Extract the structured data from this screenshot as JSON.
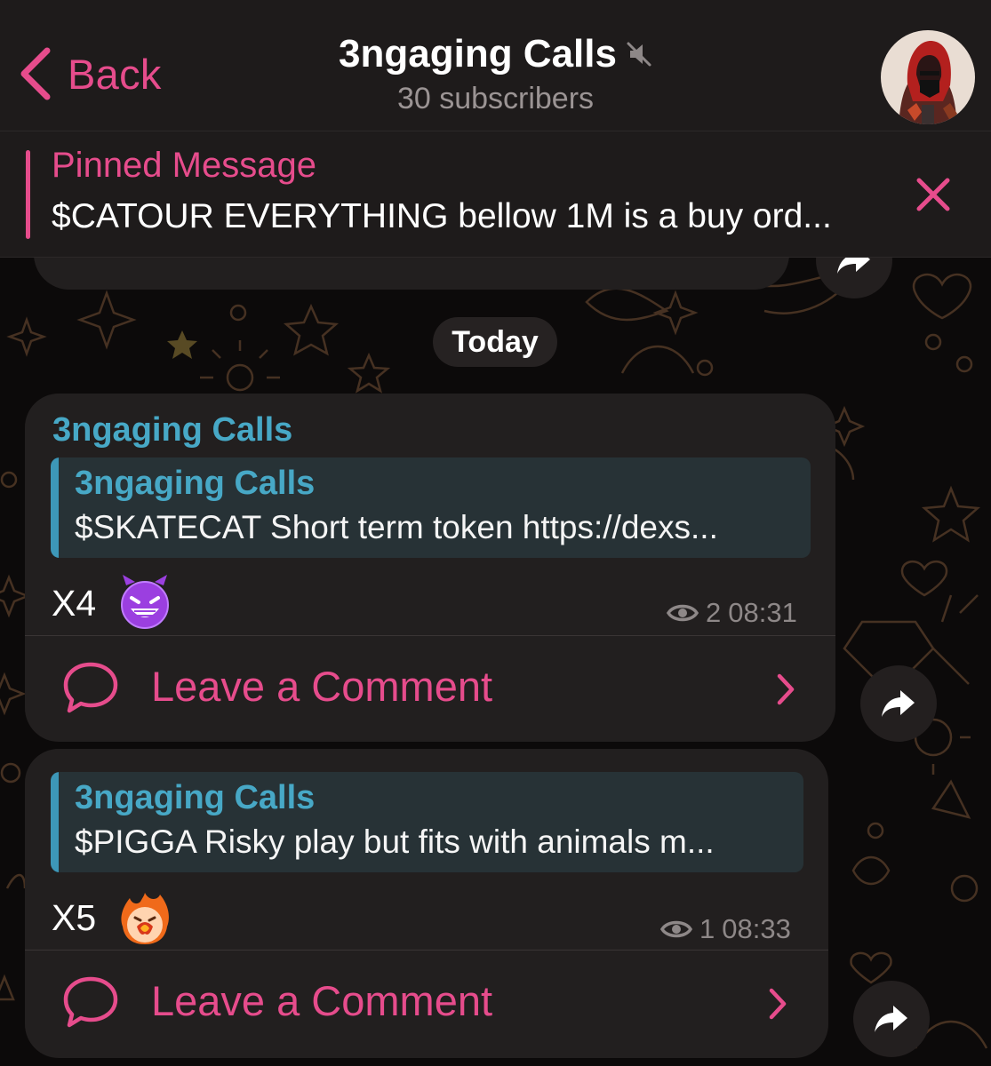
{
  "header": {
    "back_label": "Back",
    "title": "3ngaging Calls",
    "subtitle": "30 subscribers"
  },
  "pinned": {
    "title": "Pinned Message",
    "text": "$CATOUR EVERYTHING bellow 1M is a buy ord..."
  },
  "date_separator": "Today",
  "messages": [
    {
      "sender": "3ngaging Calls",
      "reply": {
        "name": "3ngaging Calls",
        "text": "$SKATECAT Short term token https://dexs..."
      },
      "text": "X4",
      "emoji": "smiling-imp-emoji",
      "views": "2",
      "time": "08:31",
      "comment_label": "Leave a Comment"
    },
    {
      "reply": {
        "name": "3ngaging Calls",
        "text": "$PIGGA Risky play but fits with animals m..."
      },
      "text": "X5",
      "emoji": "fire-face-emoji",
      "views": "1",
      "time": "08:33",
      "comment_label": "Leave a Comment"
    }
  ],
  "colors": {
    "accent": "#e64c8c",
    "sender": "#47a8c6",
    "bubble": "#221f1f",
    "header": "#1e1b1b"
  }
}
